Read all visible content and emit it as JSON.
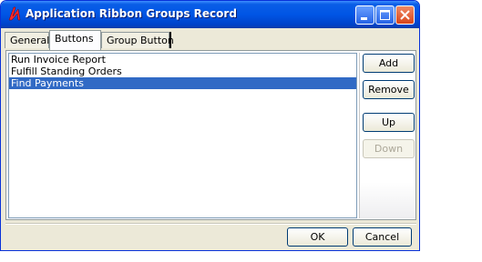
{
  "window": {
    "title": "Application Ribbon Groups  Record"
  },
  "title_buttons": {
    "minimize": "minimize-icon",
    "maximize": "maximize-icon",
    "close": "close-icon"
  },
  "tabs": [
    {
      "label": "General",
      "active": false
    },
    {
      "label": "Buttons",
      "active": true
    },
    {
      "label": "Group Button",
      "active": false
    }
  ],
  "list": {
    "items": [
      {
        "label": "Run Invoice Report",
        "selected": false
      },
      {
        "label": "Fulfill Standing Orders",
        "selected": false
      },
      {
        "label": "Find Payments",
        "selected": true
      }
    ]
  },
  "side_buttons": {
    "add": "Add",
    "remove": "Remove",
    "up": "Up",
    "down": "Down"
  },
  "footer": {
    "ok": "OK",
    "cancel": "Cancel"
  },
  "colors": {
    "titlebar": "#0055e5",
    "selection": "#316ac5",
    "dialog": "#ece9d8",
    "close": "#d9451a"
  }
}
